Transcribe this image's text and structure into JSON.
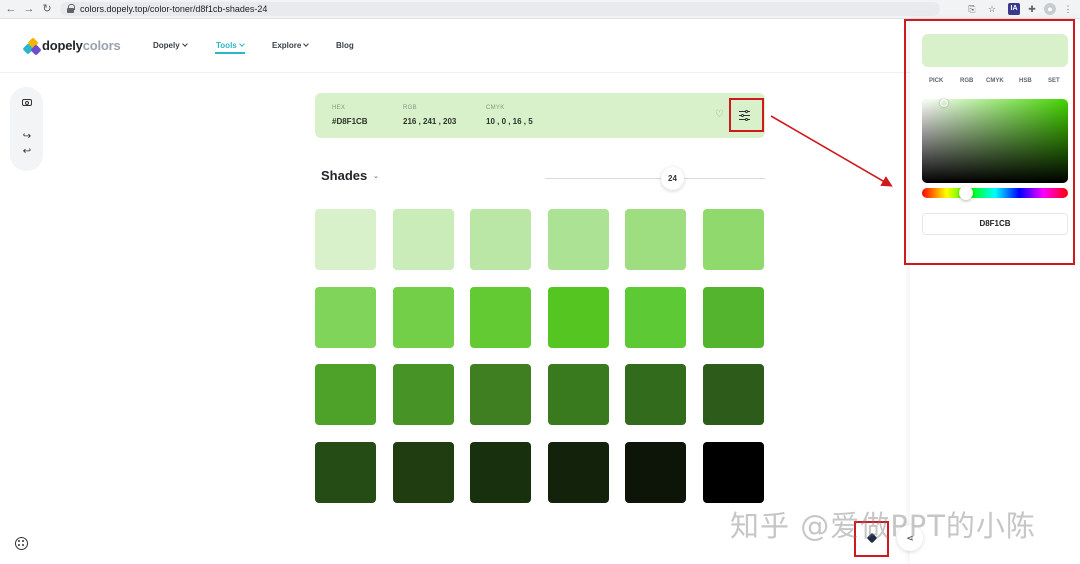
{
  "browser": {
    "back_icon": "back-arrow-icon",
    "forward_icon": "forward-arrow-icon",
    "reload_icon": "reload-icon",
    "url": "colors.dopely.top/color-toner/d8f1cb-shades-24",
    "extensions": [
      "translate-icon",
      "star-icon",
      "ia-extension-icon",
      "puzzle-icon",
      "profile-icon",
      "more-menu-icon"
    ],
    "ia_label": "IA"
  },
  "header": {
    "logo_bold": "dopely",
    "logo_light": "colors",
    "nav": [
      {
        "label": "Dopely",
        "has_caret": true
      },
      {
        "label": "Tools",
        "has_caret": true,
        "active": true
      },
      {
        "label": "Explore",
        "has_caret": true
      },
      {
        "label": "Blog",
        "has_caret": false
      }
    ],
    "accent": "#2fb6c6"
  },
  "rail": {
    "icons": [
      "camera-icon",
      "redo-icon",
      "undo-icon"
    ]
  },
  "color_info": {
    "bg": "#D8F1CB",
    "hex_label": "HEX",
    "hex_value": "#D8F1CB",
    "rgb_label": "RGB",
    "rgb_value": "216 , 241 , 203",
    "cmyk_label": "CMYK",
    "cmyk_value": "10 , 0 , 16 , 5"
  },
  "shades": {
    "title": "Shades",
    "count": "24",
    "swatches": [
      "#d8f1cb",
      "#c9ecb8",
      "#bbe7a6",
      "#ace293",
      "#9ede80",
      "#8fd96d",
      "#81d45a",
      "#72cf47",
      "#64ca34",
      "#55c521",
      "#5dc935",
      "#54b42d",
      "#4ea22a",
      "#489325",
      "#407f21",
      "#397a1f",
      "#336b1d",
      "#2d5c1a",
      "#264c16",
      "#203d12",
      "#19300e",
      "#13220a",
      "#0c1507",
      "#000000"
    ]
  },
  "picker": {
    "preview_color": "#D8F1CB",
    "tabs": [
      "PICK",
      "RGB",
      "CMYK",
      "HSB",
      "SET"
    ],
    "active_tab": "PICK",
    "hue_color": "#44d400",
    "hex_value": "D8F1CB"
  },
  "annotation_color": "#d0191e",
  "watermark": "知乎 @爱做PPT的小陈"
}
